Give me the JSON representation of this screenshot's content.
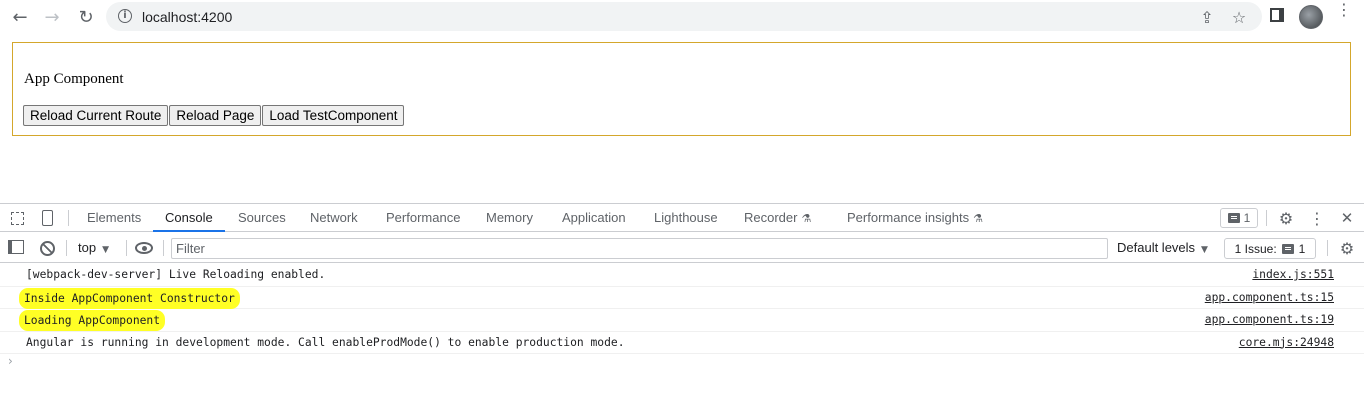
{
  "browser": {
    "url": "localhost:4200",
    "back_icon": "arrow-left-icon",
    "forward_icon": "arrow-right-icon",
    "reload_icon": "reload-icon"
  },
  "page": {
    "title": "App Component",
    "buttons": [
      "Reload Current Route",
      "Reload Page",
      "Load TestComponent"
    ]
  },
  "devtools": {
    "tabs": [
      "Elements",
      "Console",
      "Sources",
      "Network",
      "Performance",
      "Memory",
      "Application",
      "Lighthouse",
      "Recorder",
      "Performance insights"
    ],
    "active_tab": "Console",
    "message_count": "1",
    "context": "top",
    "filter_placeholder": "Filter",
    "levels": "Default levels",
    "issues": "1 Issue:",
    "issues_count": "1",
    "messages": [
      {
        "text": "[webpack-dev-server] Live Reloading enabled.",
        "source": "index.js:551",
        "highlighted": false
      },
      {
        "text": "Inside AppComponent Constructor",
        "source": "app.component.ts:15",
        "highlighted": true
      },
      {
        "text": "Loading AppComponent",
        "source": "app.component.ts:19",
        "highlighted": true
      },
      {
        "text": "Angular is running in development mode. Call enableProdMode() to enable production mode.",
        "source": "core.mjs:24948",
        "highlighted": false
      }
    ],
    "prompt": "›"
  },
  "colors": {
    "highlight": "#ffff25",
    "app_border": "#d4a72c",
    "active_tab_underline": "#1a73e8"
  }
}
